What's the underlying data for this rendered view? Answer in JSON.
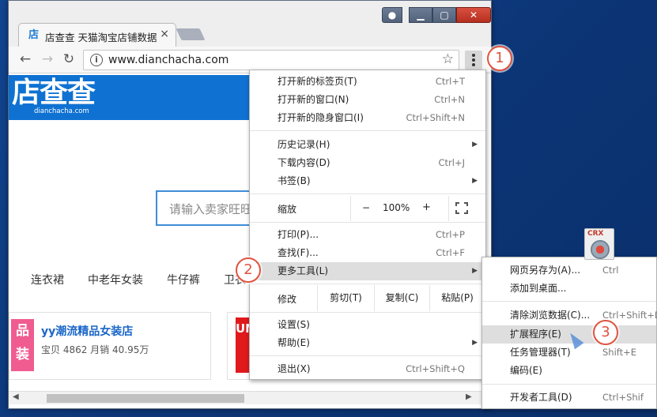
{
  "window": {
    "tab_title": "店查查 天猫淘宝店铺数据",
    "tab_close": "×",
    "favicon": "店",
    "url": "www.dianchacha.com",
    "controls": {
      "user": "●",
      "min": "▁",
      "max": "▢",
      "close": "✕"
    }
  },
  "nav": {
    "back": "←",
    "forward": "→",
    "reload": "↻",
    "info": "i",
    "star": "☆"
  },
  "page": {
    "logo": "店查查",
    "logo_sub": "dianchacha.com",
    "search_placeholder": "请输入卖家旺旺",
    "categories": [
      "连衣裙",
      "中老年女装",
      "牛仔裤",
      "卫衣"
    ],
    "shop": {
      "image_text": "品装",
      "name": "yy潮流精品女装店",
      "stats": "宝贝 4862  月销 40.95万"
    },
    "shop2_image_text": "UN"
  },
  "menu": {
    "items": [
      {
        "label": "打开新的标签页(T)",
        "shortcut": "Ctrl+T"
      },
      {
        "label": "打开新的窗口(N)",
        "shortcut": "Ctrl+N"
      },
      {
        "label": "打开新的隐身窗口(I)",
        "shortcut": "Ctrl+Shift+N"
      },
      {
        "label": "历史记录(H)",
        "shortcut": "▶"
      },
      {
        "label": "下载内容(D)",
        "shortcut": "Ctrl+J"
      },
      {
        "label": "书签(B)",
        "shortcut": "▶"
      },
      {
        "label": "打印(P)...",
        "shortcut": "Ctrl+P"
      },
      {
        "label": "查找(F)...",
        "shortcut": "Ctrl+F"
      },
      {
        "label": "更多工具(L)",
        "shortcut": "▶"
      },
      {
        "label": "设置(S)",
        "shortcut": ""
      },
      {
        "label": "帮助(E)",
        "shortcut": "▶"
      },
      {
        "label": "退出(X)",
        "shortcut": "Ctrl+Shift+Q"
      }
    ],
    "zoom": {
      "label": "缩放",
      "minus": "−",
      "value": "100%",
      "plus": "+"
    },
    "edit": {
      "label": "修改",
      "cut": "剪切(T)",
      "copy": "复制(C)",
      "paste": "粘贴(P)"
    }
  },
  "submenu": {
    "items": [
      {
        "label": "网页另存为(A)...",
        "shortcut": "Ctrl"
      },
      {
        "label": "添加到桌面...",
        "shortcut": ""
      },
      {
        "label": "清除浏览数据(C)...",
        "shortcut": "Ctrl+Shift+D"
      },
      {
        "label": "扩展程序(E)",
        "shortcut": ""
      },
      {
        "label": "任务管理器(T)",
        "shortcut": "Shift+E"
      },
      {
        "label": "编码(E)",
        "shortcut": ""
      },
      {
        "label": "开发者工具(D)",
        "shortcut": "Ctrl+Shif"
      }
    ]
  },
  "badges": [
    "1",
    "2",
    "3"
  ],
  "desktop": {
    "crx_label": "CRX"
  },
  "colors": {
    "accent": "#0f72d2",
    "badge": "#e0533f",
    "highlight": "#dedede"
  }
}
